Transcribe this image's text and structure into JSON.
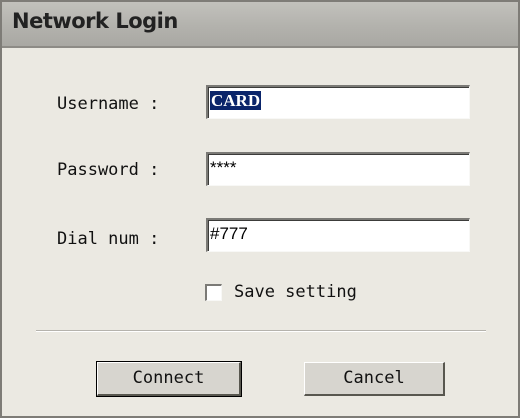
{
  "window": {
    "title": "Network Login"
  },
  "form": {
    "username_label": "Username :",
    "username_value": "CARD",
    "password_label": "Password :",
    "password_value": "****",
    "dialnum_label": "Dial num :",
    "dialnum_value": "#777",
    "save_setting_label": "Save setting",
    "save_setting_checked": false
  },
  "buttons": {
    "connect_label": "Connect",
    "cancel_label": "Cancel"
  },
  "colors": {
    "dialog_background": "#ebe9e2",
    "selection_highlight": "#0a246a"
  }
}
